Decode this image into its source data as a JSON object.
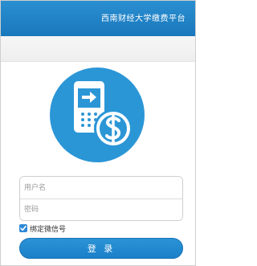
{
  "header": {
    "title": "西南财经大学缴费平台",
    "background": "#1f80c4"
  },
  "hero": {
    "icon": "phone-pay-icon",
    "circle_color": "#2b96d6"
  },
  "form": {
    "username_placeholder": "用户名",
    "password_placeholder": "密码",
    "bind_wechat_label": "绑定微信号",
    "bind_wechat_checked": true,
    "login_label": "登 录"
  }
}
